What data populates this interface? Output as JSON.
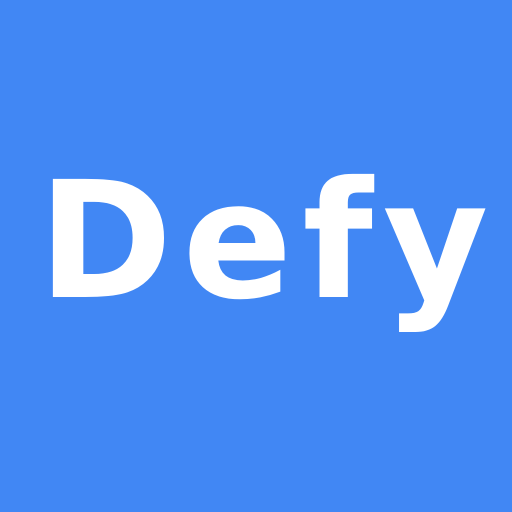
{
  "app": {
    "wordmark": "Defy",
    "background_color": "#4187f4",
    "text_color": "#ffffff"
  }
}
